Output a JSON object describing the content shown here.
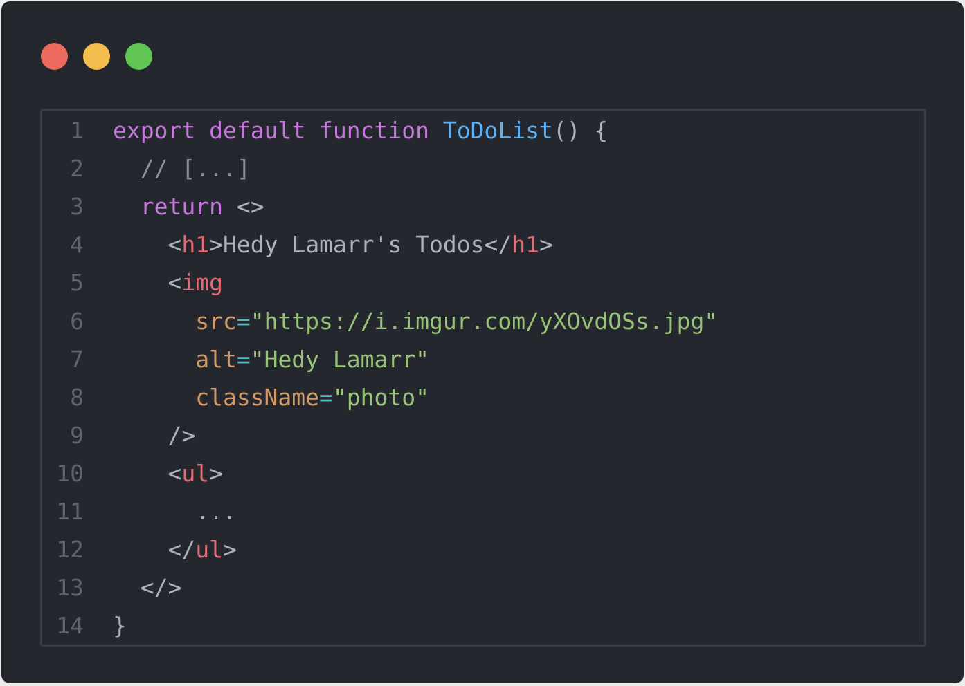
{
  "window": {
    "controls": {
      "close_color": "#ed6a5e",
      "minimize_color": "#f5bf4f",
      "maximize_color": "#61c554"
    }
  },
  "editor": {
    "lines": [
      {
        "number": "1",
        "t": {
          "kw1": "export",
          "kw2": "default",
          "kw3": "function",
          "fn": "ToDoList",
          "rest": "() {"
        }
      },
      {
        "number": "2",
        "t": {
          "comment": "// [...]"
        }
      },
      {
        "number": "3",
        "t": {
          "kw": "return",
          "rest": "<>"
        }
      },
      {
        "number": "4",
        "t": {
          "open": "<",
          "tag1": "h1",
          "mid1": ">",
          "text": "Hedy Lamarr's Todos",
          "close": "</",
          "tag2": "h1",
          "end": ">"
        }
      },
      {
        "number": "5",
        "t": {
          "open": "<",
          "tag": "img"
        }
      },
      {
        "number": "6",
        "t": {
          "attr": "src",
          "eq": "=",
          "str": "\"https://i.imgur.com/yXOvdOSs.jpg\""
        }
      },
      {
        "number": "7",
        "t": {
          "attr": "alt",
          "eq": "=",
          "str": "\"Hedy Lamarr\""
        }
      },
      {
        "number": "8",
        "t": {
          "attr": "className",
          "eq": "=",
          "str": "\"photo\""
        }
      },
      {
        "number": "9",
        "t": {
          "text": "/>"
        }
      },
      {
        "number": "10",
        "t": {
          "open": "<",
          "tag": "ul",
          "end": ">"
        }
      },
      {
        "number": "11",
        "t": {
          "text": "..."
        }
      },
      {
        "number": "12",
        "t": {
          "open": "</",
          "tag": "ul",
          "end": ">"
        }
      },
      {
        "number": "13",
        "t": {
          "text": "</>"
        }
      },
      {
        "number": "14",
        "t": {
          "text": "}"
        }
      }
    ]
  }
}
